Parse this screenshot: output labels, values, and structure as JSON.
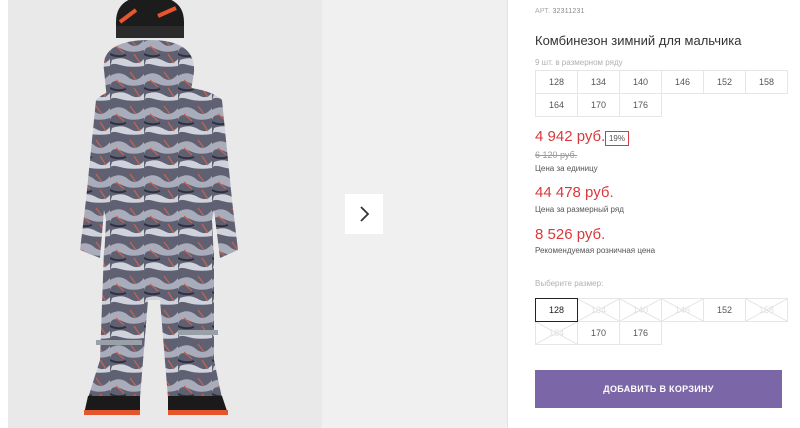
{
  "product": {
    "article_label": "АРТ.",
    "article_number": "32311231",
    "title": "Комбинезон зимний для мальчика",
    "image_alt": "product-photo-boy-snowsuit-back-view"
  },
  "size_row": {
    "caption": "9 шт. в размерном ряду",
    "sizes": [
      "128",
      "134",
      "140",
      "146",
      "152",
      "158",
      "164",
      "170",
      "176"
    ]
  },
  "prices": {
    "unit_price": "4 942 руб.",
    "discount_badge": "19%",
    "old_price": "6 120 руб.",
    "unit_caption": "Цена за единицу",
    "row_price": "44 478 руб.",
    "row_caption": "Цена за размерный ряд",
    "rrp_price": "8 526 руб.",
    "rrp_caption": "Рекомендуемая розничная цена"
  },
  "size_picker": {
    "caption": "Выберите размер:",
    "selected": "128",
    "options": [
      {
        "label": "128",
        "available": true
      },
      {
        "label": "134",
        "available": false
      },
      {
        "label": "140",
        "available": false
      },
      {
        "label": "146",
        "available": false
      },
      {
        "label": "152",
        "available": true
      },
      {
        "label": "158",
        "available": false
      },
      {
        "label": "164",
        "available": false
      },
      {
        "label": "170",
        "available": true
      },
      {
        "label": "176",
        "available": true
      }
    ]
  },
  "actions": {
    "add_to_cart": "ДОБАВИТЬ В КОРЗИНУ"
  },
  "colors": {
    "price_red": "#d9393c",
    "accent_purple": "#7b66a8"
  },
  "icons": {
    "gallery_next": "chevron-right-icon"
  }
}
